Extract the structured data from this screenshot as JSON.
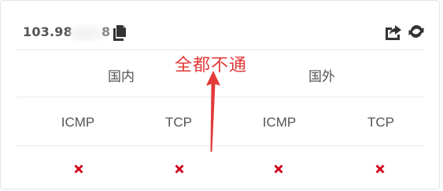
{
  "header": {
    "ip_visible": "103.98",
    "ip_suffix": "8"
  },
  "regions": {
    "domestic": "国内",
    "foreign": "国外"
  },
  "protocols": [
    "ICMP",
    "TCP",
    "ICMP",
    "TCP"
  ],
  "status": [
    "fail",
    "fail",
    "fail",
    "fail"
  ],
  "annotation": {
    "text": "全都不通"
  },
  "colors": {
    "fail": "#d0021b",
    "annotation": "#e23a3a",
    "text": "#555555",
    "divider": "#e8e8e8"
  },
  "icons": {
    "copy": "copy-icon",
    "share": "share-icon",
    "refresh": "refresh-icon",
    "fail": "x-mark-icon"
  }
}
